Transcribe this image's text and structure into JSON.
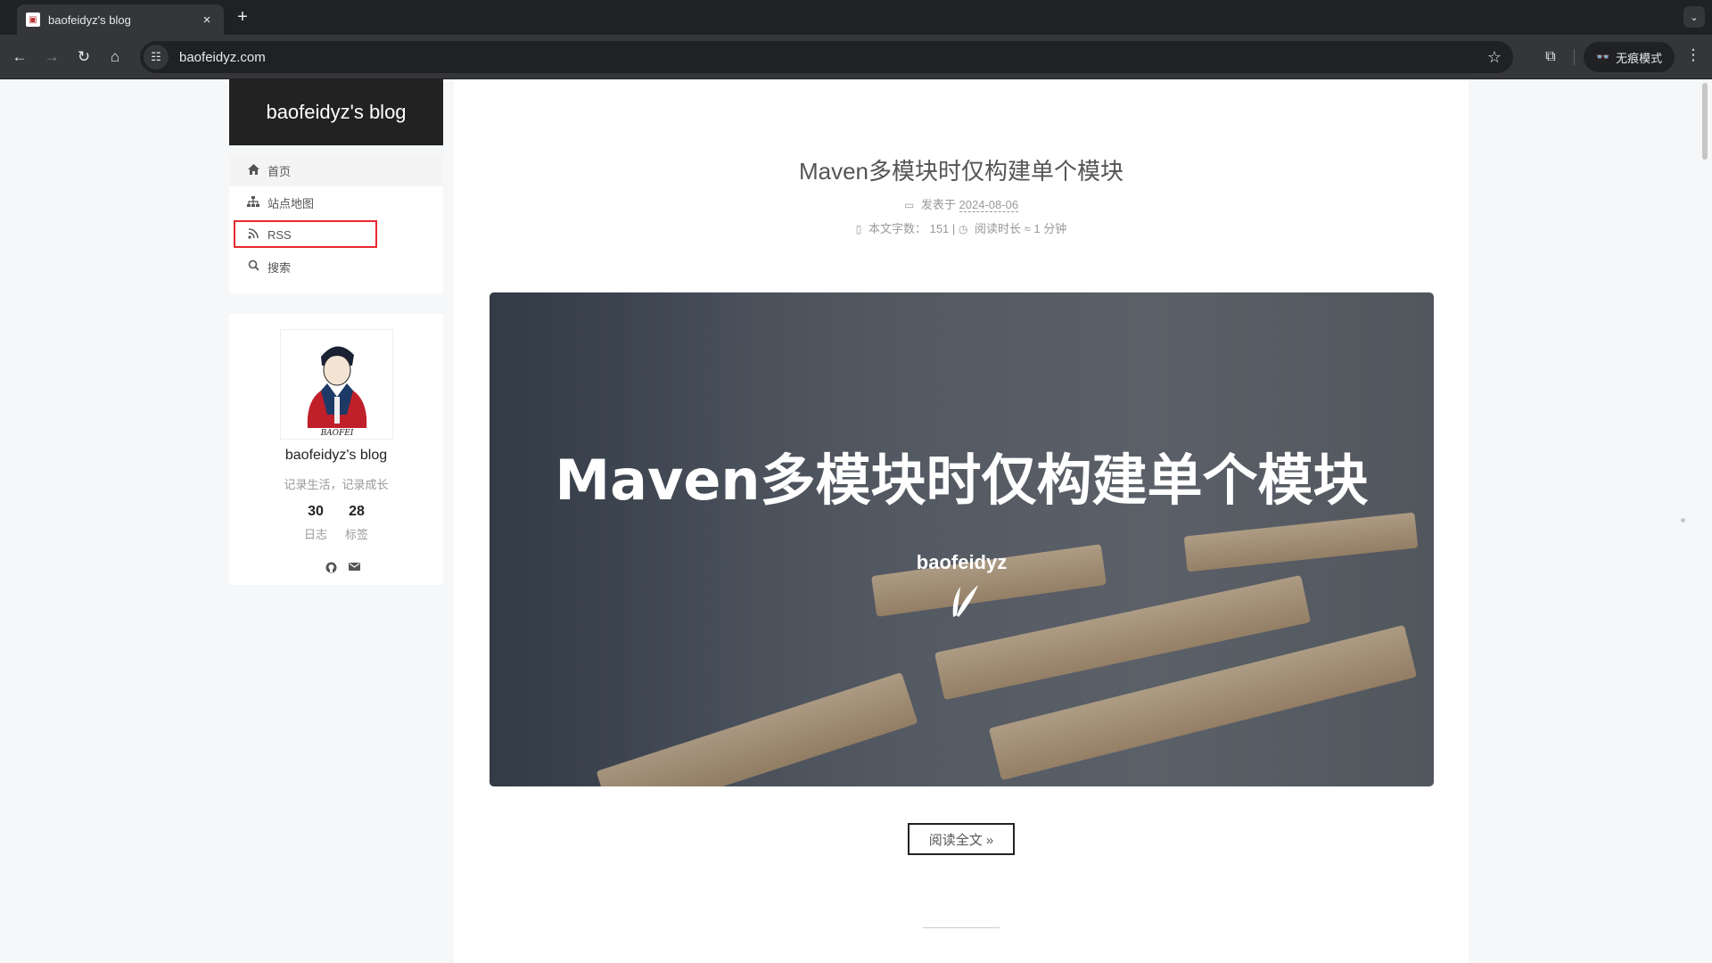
{
  "browser": {
    "tab_title": "baofeidyz's blog",
    "tab_close": "×",
    "new_tab": "+",
    "url": "baofeidyz.com",
    "incognito_label": "无痕模式"
  },
  "site": {
    "brand": "baofeidyz's blog"
  },
  "menu": {
    "items": [
      {
        "label": "首页",
        "icon": "home-icon"
      },
      {
        "label": "站点地图",
        "icon": "sitemap-icon"
      },
      {
        "label": "RSS",
        "icon": "rss-icon"
      },
      {
        "label": "搜索",
        "icon": "search-icon"
      }
    ]
  },
  "author": {
    "name": "baofeidyz's blog",
    "description": "记录生活，记录成长",
    "posts_count": "30",
    "posts_label": "日志",
    "tags_count": "28",
    "tags_label": "标签"
  },
  "post": {
    "title": "Maven多模块时仅构建单个模块",
    "published_label": "发表于",
    "published_date": "2024-08-06",
    "wordcount_label": "本文字数：",
    "wordcount": "151",
    "meta_separator": "|",
    "readtime_label": "阅读时长 ≈",
    "readtime": "1 分钟",
    "banner_title": "Maven多模块时仅构建单个模块",
    "banner_brand": "baofeidyz",
    "read_more": "阅读全文 »"
  },
  "colors": {
    "highlight": "#e8282f",
    "header_bg": "#222222"
  }
}
